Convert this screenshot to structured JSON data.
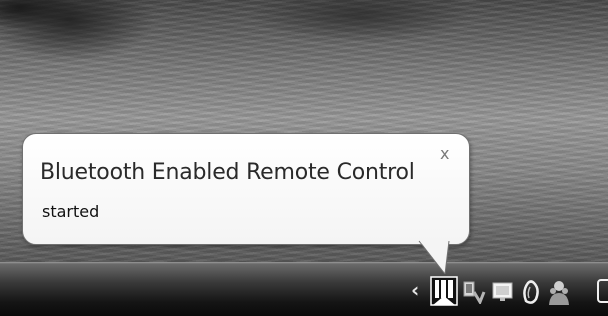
{
  "notification": {
    "title": "Bluetooth Enabled Remote Control",
    "message": "started",
    "close_label": "x"
  },
  "tray": {
    "expand_label": "‹",
    "icons": [
      "bluetooth-remote-icon",
      "network-icon",
      "display-icon",
      "volume-icon",
      "users-icon",
      "show-desktop-icon"
    ]
  }
}
